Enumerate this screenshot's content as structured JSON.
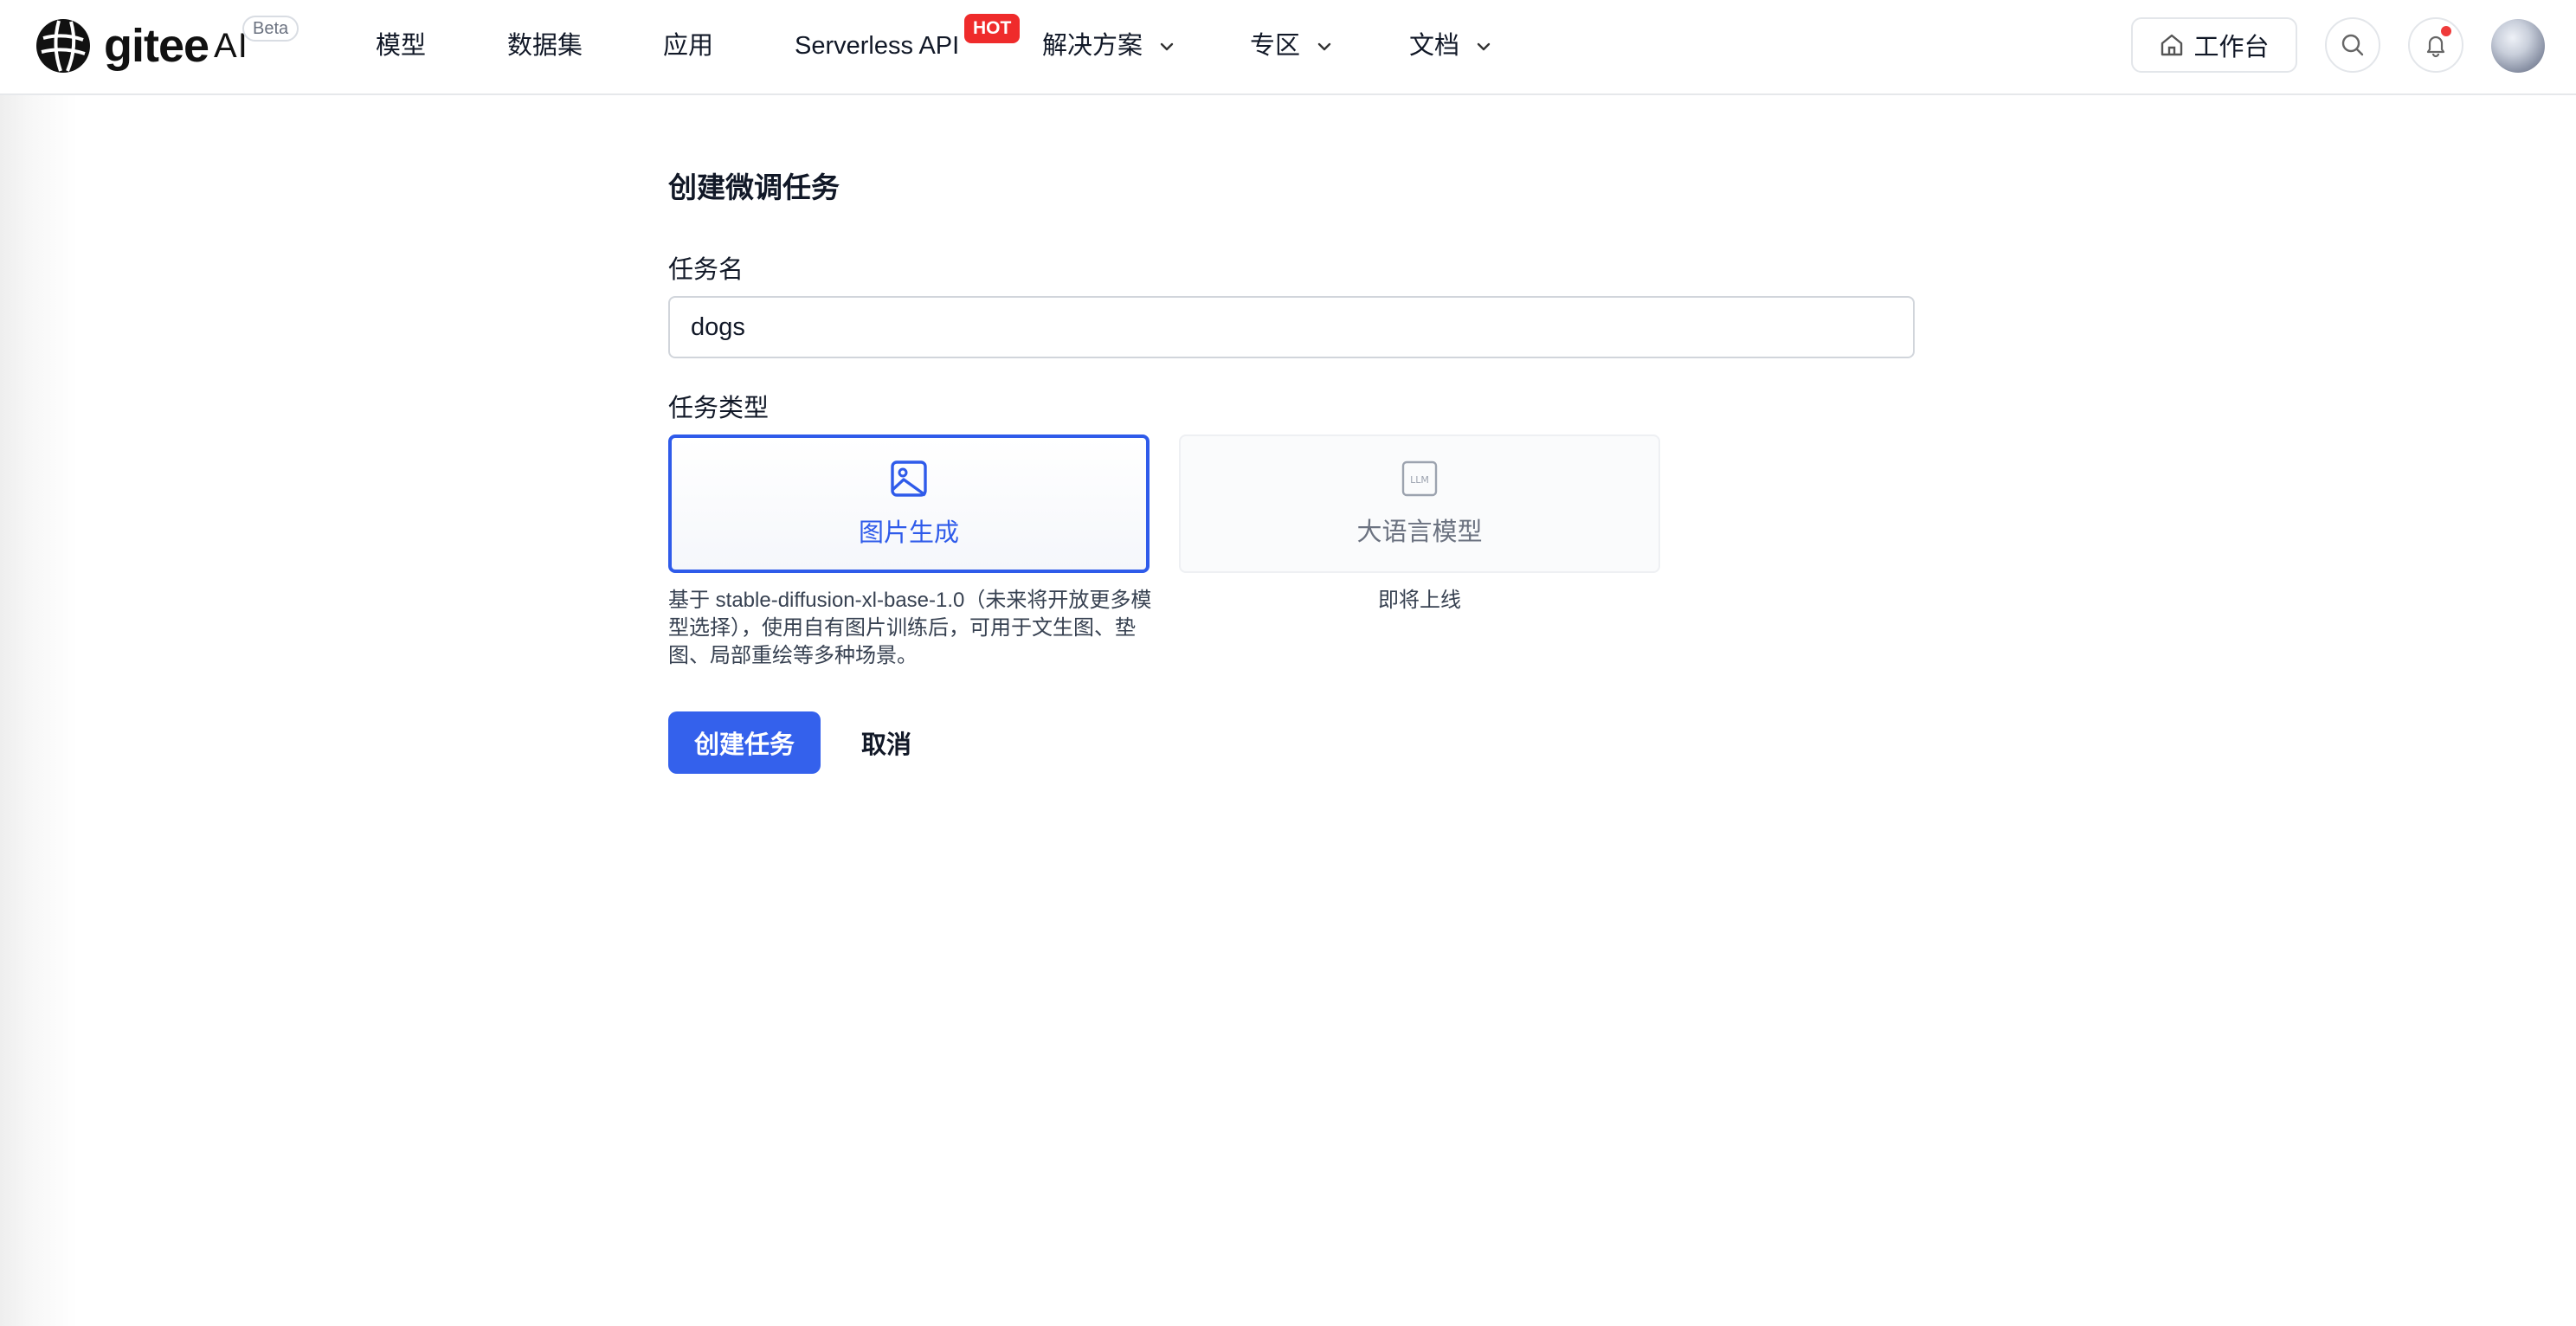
{
  "header": {
    "logo": {
      "text": "gitee",
      "ai": "AI",
      "badge": "Beta"
    },
    "nav": [
      {
        "label": "模型"
      },
      {
        "label": "数据集"
      },
      {
        "label": "应用"
      },
      {
        "label": "Serverless API",
        "badge": "HOT"
      },
      {
        "label": "解决方案",
        "has_dropdown": true
      },
      {
        "label": "专区",
        "has_dropdown": true
      },
      {
        "label": "文档",
        "has_dropdown": true
      }
    ],
    "workbench_label": "工作台",
    "icons": {
      "home": "home-icon",
      "search": "search-icon",
      "bell": "bell-icon",
      "avatar": "avatar"
    },
    "notification_dot": true
  },
  "form": {
    "title": "创建微调任务",
    "name_label": "任务名",
    "name_value": "dogs",
    "type_label": "任务类型",
    "types": [
      {
        "label": "图片生成",
        "icon": "image-icon",
        "selected": true,
        "description": "基于 stable-diffusion-xl-base-1.0（未来将开放更多模型选择），使用自有图片训练后，可用于文生图、垫图、局部重绘等多种场景。"
      },
      {
        "label": "大语言模型",
        "icon": "llm-icon",
        "icon_text": "LLM",
        "selected": false,
        "description": "即将上线"
      }
    ],
    "submit_label": "创建任务",
    "cancel_label": "取消"
  },
  "colors": {
    "accent": "#3461ec",
    "selected_border": "#2f5bea",
    "hot_badge": "#ef2b2b",
    "notification_dot": "#ef3b3b"
  }
}
